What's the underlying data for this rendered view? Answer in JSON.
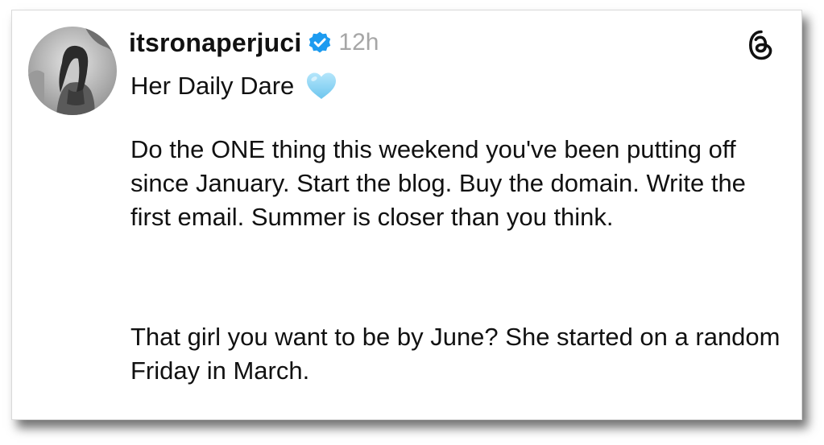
{
  "post": {
    "username": "itsronaperjuci",
    "time": "12h",
    "title": "Her Daily Dare",
    "paragraphs": [
      "Do the ONE thing this weekend you've been putting off since January. Start the blog. Buy the domain. Write the first email. Summer is closer than you think.",
      "That girl you want to be by June? She started on a random Friday in March."
    ]
  },
  "icons": {
    "avatar": "profile-photo",
    "verified": "verified-badge-icon",
    "logo": "threads-logo-icon",
    "emoji": "light-blue-heart-icon"
  },
  "colors": {
    "verified_blue": "#1d9bf0",
    "heart_blue": "#8fd3f4",
    "time_gray": "#a6a6a6",
    "text": "#111111"
  }
}
